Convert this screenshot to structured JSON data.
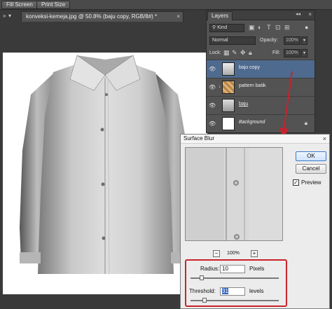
{
  "options_bar": {
    "fill_screen_label": "Fill Screen",
    "print_size_label": "Print Size"
  },
  "document": {
    "tab_label": "konveksi-kemeja.jpg @ 50.8% (baju copy, RGB/8#) *",
    "close_glyph": "×",
    "overflow_glyph": "»",
    "menu_glyph": "▾"
  },
  "layers_panel": {
    "tab_label": "Layers",
    "close_glyph": "×",
    "collapse_glyph": "◂◂",
    "filter": {
      "kind_label": "Kind"
    },
    "blend_mode": "Normal",
    "opacity_label": "Opacity:",
    "opacity_value": "100%",
    "lock_label": "Lock:",
    "fill_label": "Fill:",
    "fill_value": "100%",
    "layers": [
      {
        "name": "baju copy",
        "selected": true
      },
      {
        "name": "pattern batik",
        "selected": false
      },
      {
        "name": "baju",
        "selected": false
      },
      {
        "name": "Background",
        "selected": false,
        "locked": true
      }
    ]
  },
  "dialog": {
    "title": "Surface Blur",
    "close_glyph": "×",
    "ok_label": "OK",
    "cancel_label": "Cancel",
    "preview_label": "Preview",
    "preview_checked": true,
    "zoom_value": "100%",
    "zoom_out_glyph": "−",
    "zoom_in_glyph": "+",
    "radius_label": "Radius:",
    "radius_value": "10",
    "radius_unit": "Pixels",
    "threshold_label": "Threshold:",
    "threshold_value": "31",
    "threshold_unit": "levels"
  },
  "colors": {
    "accent_red": "#c8232c",
    "selection_blue": "#4e6a8e"
  }
}
